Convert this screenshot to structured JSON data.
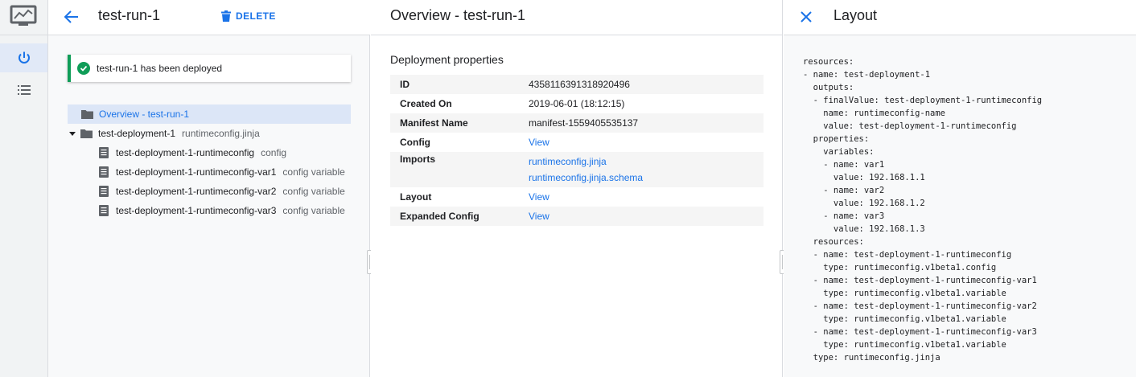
{
  "rail": {
    "logo_icon": "deployment-manager-logo-icon",
    "items": [
      {
        "icon": "power-icon",
        "active": true
      },
      {
        "icon": "list-icon",
        "active": false
      }
    ]
  },
  "panel1": {
    "title": "test-run-1",
    "delete_label": "DELETE",
    "toast": "test-run-1 has been deployed",
    "tree": {
      "overview": "Overview - test-run-1",
      "deployment": {
        "label": "test-deployment-1",
        "sub": "runtimeconfig.jinja"
      },
      "children": [
        {
          "label": "test-deployment-1-runtimeconfig",
          "sub": "config"
        },
        {
          "label": "test-deployment-1-runtimeconfig-var1",
          "sub": "config variable"
        },
        {
          "label": "test-deployment-1-runtimeconfig-var2",
          "sub": "config variable"
        },
        {
          "label": "test-deployment-1-runtimeconfig-var3",
          "sub": "config variable"
        }
      ]
    }
  },
  "panel2": {
    "title": "Overview - test-run-1",
    "section": "Deployment properties",
    "props": {
      "id": {
        "k": "ID",
        "v": "4358116391318920496"
      },
      "created": {
        "k": "Created On",
        "v": "2019-06-01 (18:12:15)"
      },
      "manifest": {
        "k": "Manifest Name",
        "v": "manifest-1559405535137"
      },
      "config": {
        "k": "Config",
        "v": "View"
      },
      "imports": {
        "k": "Imports",
        "v1": "runtimeconfig.jinja",
        "v2": "runtimeconfig.jinja.schema"
      },
      "layout": {
        "k": "Layout",
        "v": "View"
      },
      "expanded": {
        "k": "Expanded Config",
        "v": "View"
      }
    }
  },
  "panel3": {
    "title": "Layout",
    "yaml": "resources:\n- name: test-deployment-1\n  outputs:\n  - finalValue: test-deployment-1-runtimeconfig\n    name: runtimeconfig-name\n    value: test-deployment-1-runtimeconfig\n  properties:\n    variables:\n    - name: var1\n      value: 192.168.1.1\n    - name: var2\n      value: 192.168.1.2\n    - name: var3\n      value: 192.168.1.3\n  resources:\n  - name: test-deployment-1-runtimeconfig\n    type: runtimeconfig.v1beta1.config\n  - name: test-deployment-1-runtimeconfig-var1\n    type: runtimeconfig.v1beta1.variable\n  - name: test-deployment-1-runtimeconfig-var2\n    type: runtimeconfig.v1beta1.variable\n  - name: test-deployment-1-runtimeconfig-var3\n    type: runtimeconfig.v1beta1.variable\n  type: runtimeconfig.jinja"
  },
  "colors": {
    "accent": "#1a73e8",
    "success": "#0f9d58",
    "selected_bg": "#dce6f7"
  }
}
